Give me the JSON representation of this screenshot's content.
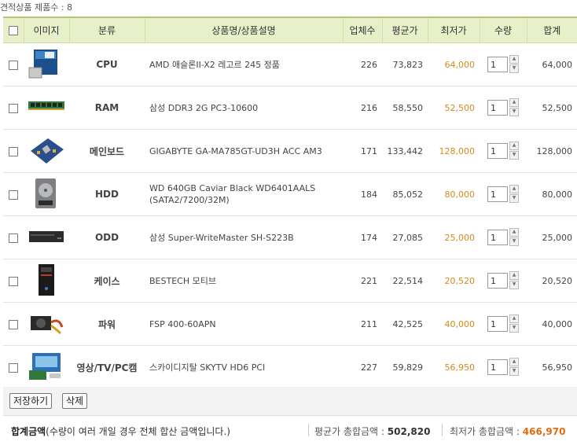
{
  "count_label": "견적상품 제품수 : 8",
  "columns": {
    "image": "이미지",
    "category": "분류",
    "name": "상품명/상품설명",
    "vendors": "업체수",
    "avg_price": "평균가",
    "low_price": "최저가",
    "qty": "수량",
    "total": "합계"
  },
  "rows": [
    {
      "category": "CPU",
      "name": "AMD 애슬론II-X2 레고르 245 정품",
      "vendors": "226",
      "avg": "73,823",
      "low": "64,000",
      "qty": "1",
      "total": "64,000",
      "icon": "cpu-box"
    },
    {
      "category": "RAM",
      "name": "삼성 DDR3 2G PC3-10600",
      "vendors": "216",
      "avg": "58,550",
      "low": "52,500",
      "qty": "1",
      "total": "52,500",
      "icon": "ram-stick"
    },
    {
      "category": "메인보드",
      "name": "GIGABYTE GA-MA785GT-UD3H ACC AM3",
      "vendors": "171",
      "avg": "133,442",
      "low": "128,000",
      "qty": "1",
      "total": "128,000",
      "icon": "motherboard"
    },
    {
      "category": "HDD",
      "name": "WD 640GB Caviar Black WD6401AALS (SATA2/7200/32M)",
      "vendors": "184",
      "avg": "85,052",
      "low": "80,000",
      "qty": "1",
      "total": "80,000",
      "icon": "hard-drive"
    },
    {
      "category": "ODD",
      "name": "삼성 Super-WriteMaster SH-S223B",
      "vendors": "174",
      "avg": "27,085",
      "low": "25,000",
      "qty": "1",
      "total": "25,000",
      "icon": "optical-drive"
    },
    {
      "category": "케이스",
      "name": "BESTECH 모티브",
      "vendors": "221",
      "avg": "22,514",
      "low": "20,520",
      "qty": "1",
      "total": "20,520",
      "icon": "pc-case"
    },
    {
      "category": "파워",
      "name": "FSP 400-60APN",
      "vendors": "211",
      "avg": "42,525",
      "low": "40,000",
      "qty": "1",
      "total": "40,000",
      "icon": "power-supply"
    },
    {
      "category": "영상/TV/PC캠",
      "name": "스카이디지탈 SKYTV HD6 PCI",
      "vendors": "227",
      "avg": "59,829",
      "low": "56,950",
      "qty": "1",
      "total": "56,950",
      "icon": "tv-card"
    }
  ],
  "buttons": {
    "save": "저장하기",
    "delete": "삭제"
  },
  "summary": {
    "label_bold": "합계금액",
    "label_note": "(수량이 여러 개일 경우 전체 합산 금액입니다.)",
    "avg_label": "평균가 총합금액 :",
    "avg_value": "502,820",
    "low_label": "최저가 총합금액 :",
    "low_value": "466,970"
  },
  "colors": {
    "header_bg": "#e7f0c8",
    "low_price": "#d68a1c",
    "low_total": "#e06b12"
  }
}
